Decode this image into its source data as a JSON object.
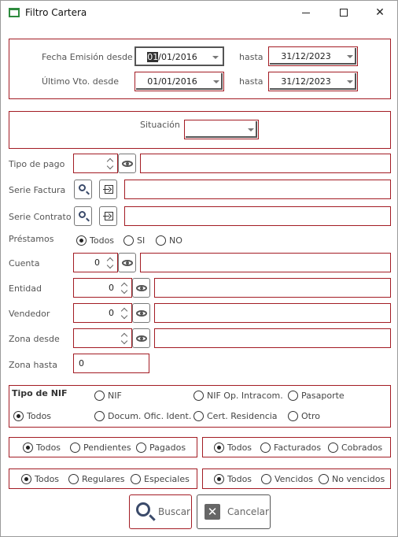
{
  "window": {
    "title": "Filtro Cartera",
    "min_glyph": "",
    "max_glyph": "",
    "close_glyph": "✕"
  },
  "fechas": {
    "emision_label": "Fecha Emisión desde",
    "emision_desde": "01/01/2016",
    "emision_desde_selected": "01",
    "emision_desde_rest": "/01/2016",
    "emision_hasta_label": "hasta",
    "emision_hasta": "31/12/2023",
    "vto_label": "Último Vto. desde",
    "vto_desde": "01/01/2016",
    "vto_hasta_label": "hasta",
    "vto_hasta": "31/12/2023"
  },
  "situacion": {
    "label": "Situación",
    "value": ""
  },
  "tipo_pago": {
    "label": "Tipo de pago",
    "value": "",
    "description": ""
  },
  "serie_factura": {
    "label": "Serie Factura",
    "value": ""
  },
  "serie_contrato": {
    "label": "Serie Contrato",
    "value": ""
  },
  "prestamos": {
    "label": "Préstamos",
    "options": [
      "Todos",
      "SI",
      "NO"
    ],
    "selected": "Todos"
  },
  "cuenta": {
    "label": "Cuenta",
    "value": "0",
    "description": ""
  },
  "entidad": {
    "label": "Entidad",
    "value": "0",
    "description": ""
  },
  "vendedor": {
    "label": "Vendedor",
    "value": "0",
    "description": ""
  },
  "zona_desde": {
    "label": "Zona desde",
    "value": "",
    "description": ""
  },
  "zona_hasta": {
    "label": "Zona hasta",
    "value": "0"
  },
  "tipo_nif": {
    "label": "Tipo de NIF",
    "options": [
      "NIF",
      "NIF Op. Intracom.",
      "Pasaporte",
      "Todos",
      "Docum. Ofic. Ident.",
      "Cert. Residencia",
      "Otro"
    ],
    "selected": "Todos"
  },
  "grupo_pendientes": {
    "options": [
      "Todos",
      "Pendientes",
      "Pagados"
    ],
    "selected": "Todos"
  },
  "grupo_facturados": {
    "options": [
      "Todos",
      "Facturados",
      "Cobrados"
    ],
    "selected": "Todos"
  },
  "grupo_regulares": {
    "options": [
      "Todos",
      "Regulares",
      "Especiales"
    ],
    "selected": "Todos"
  },
  "grupo_vencidos": {
    "options": [
      "Todos",
      "Vencidos",
      "No vencidos"
    ],
    "selected": "Todos"
  },
  "buttons": {
    "buscar": "Buscar",
    "cancelar": "Cancelar",
    "cancel_glyph": "✕"
  },
  "colors": {
    "accent": "#a31c24",
    "title_icon": "#2e8b3e"
  }
}
